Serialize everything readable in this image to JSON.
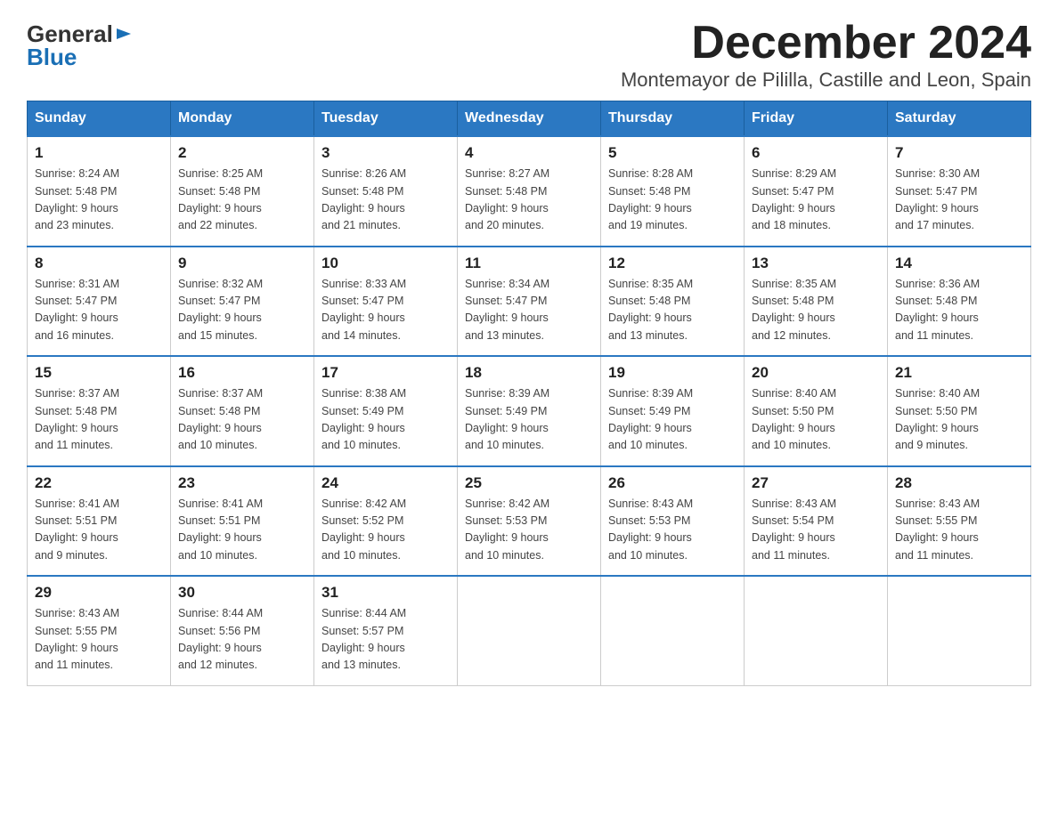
{
  "logo": {
    "general": "General",
    "blue": "Blue",
    "arrow": "▶"
  },
  "title": "December 2024",
  "subtitle": "Montemayor de Pililla, Castille and Leon, Spain",
  "days_of_week": [
    "Sunday",
    "Monday",
    "Tuesday",
    "Wednesday",
    "Thursday",
    "Friday",
    "Saturday"
  ],
  "weeks": [
    [
      {
        "day": "1",
        "sunrise": "8:24 AM",
        "sunset": "5:48 PM",
        "daylight": "9 hours and 23 minutes."
      },
      {
        "day": "2",
        "sunrise": "8:25 AM",
        "sunset": "5:48 PM",
        "daylight": "9 hours and 22 minutes."
      },
      {
        "day": "3",
        "sunrise": "8:26 AM",
        "sunset": "5:48 PM",
        "daylight": "9 hours and 21 minutes."
      },
      {
        "day": "4",
        "sunrise": "8:27 AM",
        "sunset": "5:48 PM",
        "daylight": "9 hours and 20 minutes."
      },
      {
        "day": "5",
        "sunrise": "8:28 AM",
        "sunset": "5:48 PM",
        "daylight": "9 hours and 19 minutes."
      },
      {
        "day": "6",
        "sunrise": "8:29 AM",
        "sunset": "5:47 PM",
        "daylight": "9 hours and 18 minutes."
      },
      {
        "day": "7",
        "sunrise": "8:30 AM",
        "sunset": "5:47 PM",
        "daylight": "9 hours and 17 minutes."
      }
    ],
    [
      {
        "day": "8",
        "sunrise": "8:31 AM",
        "sunset": "5:47 PM",
        "daylight": "9 hours and 16 minutes."
      },
      {
        "day": "9",
        "sunrise": "8:32 AM",
        "sunset": "5:47 PM",
        "daylight": "9 hours and 15 minutes."
      },
      {
        "day": "10",
        "sunrise": "8:33 AM",
        "sunset": "5:47 PM",
        "daylight": "9 hours and 14 minutes."
      },
      {
        "day": "11",
        "sunrise": "8:34 AM",
        "sunset": "5:47 PM",
        "daylight": "9 hours and 13 minutes."
      },
      {
        "day": "12",
        "sunrise": "8:35 AM",
        "sunset": "5:48 PM",
        "daylight": "9 hours and 13 minutes."
      },
      {
        "day": "13",
        "sunrise": "8:35 AM",
        "sunset": "5:48 PM",
        "daylight": "9 hours and 12 minutes."
      },
      {
        "day": "14",
        "sunrise": "8:36 AM",
        "sunset": "5:48 PM",
        "daylight": "9 hours and 11 minutes."
      }
    ],
    [
      {
        "day": "15",
        "sunrise": "8:37 AM",
        "sunset": "5:48 PM",
        "daylight": "9 hours and 11 minutes."
      },
      {
        "day": "16",
        "sunrise": "8:37 AM",
        "sunset": "5:48 PM",
        "daylight": "9 hours and 10 minutes."
      },
      {
        "day": "17",
        "sunrise": "8:38 AM",
        "sunset": "5:49 PM",
        "daylight": "9 hours and 10 minutes."
      },
      {
        "day": "18",
        "sunrise": "8:39 AM",
        "sunset": "5:49 PM",
        "daylight": "9 hours and 10 minutes."
      },
      {
        "day": "19",
        "sunrise": "8:39 AM",
        "sunset": "5:49 PM",
        "daylight": "9 hours and 10 minutes."
      },
      {
        "day": "20",
        "sunrise": "8:40 AM",
        "sunset": "5:50 PM",
        "daylight": "9 hours and 10 minutes."
      },
      {
        "day": "21",
        "sunrise": "8:40 AM",
        "sunset": "5:50 PM",
        "daylight": "9 hours and 9 minutes."
      }
    ],
    [
      {
        "day": "22",
        "sunrise": "8:41 AM",
        "sunset": "5:51 PM",
        "daylight": "9 hours and 9 minutes."
      },
      {
        "day": "23",
        "sunrise": "8:41 AM",
        "sunset": "5:51 PM",
        "daylight": "9 hours and 10 minutes."
      },
      {
        "day": "24",
        "sunrise": "8:42 AM",
        "sunset": "5:52 PM",
        "daylight": "9 hours and 10 minutes."
      },
      {
        "day": "25",
        "sunrise": "8:42 AM",
        "sunset": "5:53 PM",
        "daylight": "9 hours and 10 minutes."
      },
      {
        "day": "26",
        "sunrise": "8:43 AM",
        "sunset": "5:53 PM",
        "daylight": "9 hours and 10 minutes."
      },
      {
        "day": "27",
        "sunrise": "8:43 AM",
        "sunset": "5:54 PM",
        "daylight": "9 hours and 11 minutes."
      },
      {
        "day": "28",
        "sunrise": "8:43 AM",
        "sunset": "5:55 PM",
        "daylight": "9 hours and 11 minutes."
      }
    ],
    [
      {
        "day": "29",
        "sunrise": "8:43 AM",
        "sunset": "5:55 PM",
        "daylight": "9 hours and 11 minutes."
      },
      {
        "day": "30",
        "sunrise": "8:44 AM",
        "sunset": "5:56 PM",
        "daylight": "9 hours and 12 minutes."
      },
      {
        "day": "31",
        "sunrise": "8:44 AM",
        "sunset": "5:57 PM",
        "daylight": "9 hours and 13 minutes."
      },
      null,
      null,
      null,
      null
    ]
  ],
  "labels": {
    "sunrise": "Sunrise:",
    "sunset": "Sunset:",
    "daylight": "Daylight:"
  }
}
